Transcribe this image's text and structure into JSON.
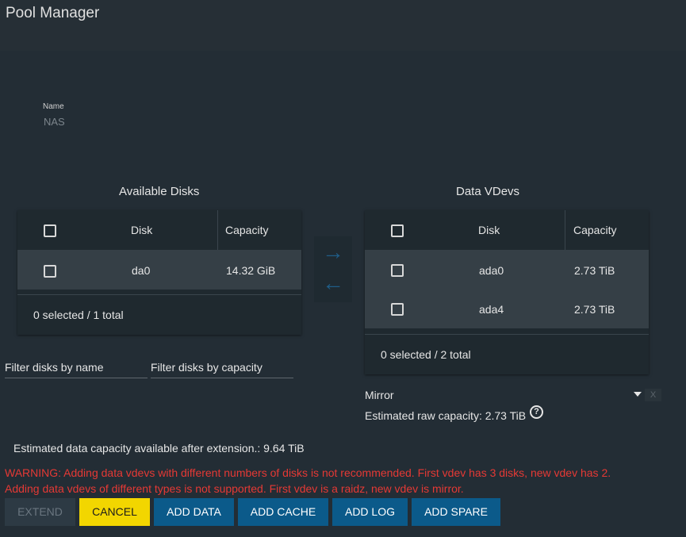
{
  "page": {
    "title": "Pool Manager"
  },
  "name_field": {
    "label": "Name",
    "value": "NAS"
  },
  "available": {
    "title": "Available Disks",
    "col_disk": "Disk",
    "col_capacity": "Capacity",
    "rows": [
      {
        "disk": "da0",
        "capacity": "14.32 GiB"
      }
    ],
    "footer": "0 selected / 1 total"
  },
  "vdevs": {
    "title": "Data VDevs",
    "col_disk": "Disk",
    "col_capacity": "Capacity",
    "rows": [
      {
        "disk": "ada0",
        "capacity": "2.73 TiB"
      },
      {
        "disk": "ada4",
        "capacity": "2.73 TiB"
      }
    ],
    "footer": "0 selected / 2 total",
    "layout_value": "Mirror",
    "clear_label": "X",
    "estimated_raw": "Estimated raw capacity: 2.73 TiB"
  },
  "filters": {
    "by_name": "Filter disks by name",
    "by_capacity": "Filter disks by capacity"
  },
  "estimated_data": "Estimated data capacity available after extension.: 9.64 TiB",
  "warnings": [
    "WARNING: Adding data vdevs with different numbers of disks is not recommended. First vdev has 3 disks, new vdev has 2.",
    "Adding data vdevs of different types is not supported. First vdev is a raidz, new vdev is mirror."
  ],
  "buttons": {
    "extend": "EXTEND",
    "cancel": "CANCEL",
    "add_data": "ADD DATA",
    "add_cache": "ADD CACHE",
    "add_log": "ADD LOG",
    "add_spare": "ADD SPARE"
  },
  "icons": {
    "arrow_right": "arrow-right-icon",
    "arrow_left": "arrow-left-icon",
    "help": "help-circle-icon",
    "caret": "caret-down-icon"
  },
  "colors": {
    "primary": "#0b5a8a",
    "cancel": "#f2d600",
    "warning": "#e53935",
    "background": "#232d35"
  }
}
